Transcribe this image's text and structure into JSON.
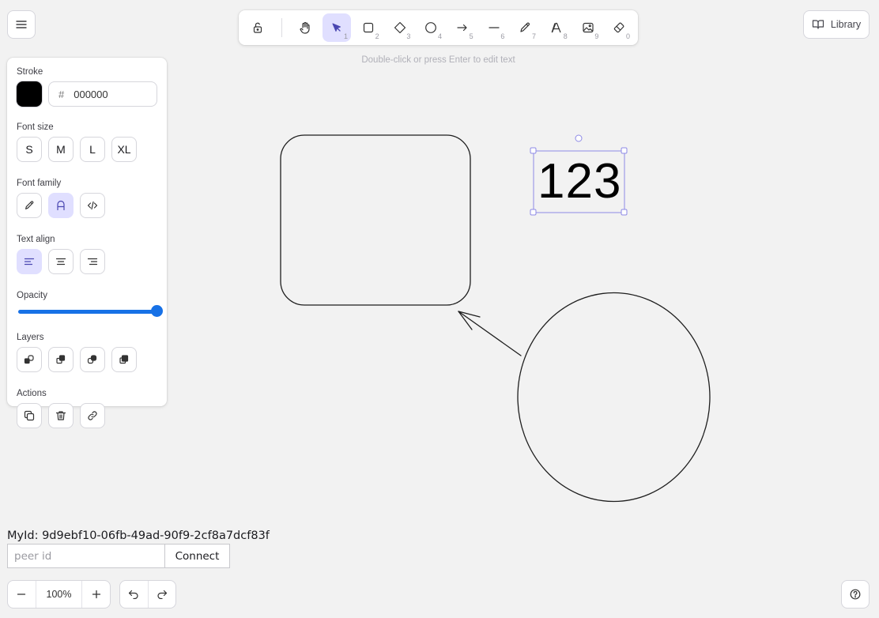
{
  "toolbar": {
    "tools": [
      {
        "name": "lock",
        "key": ""
      },
      {
        "name": "hand",
        "key": ""
      },
      {
        "name": "selection",
        "key": "1"
      },
      {
        "name": "rectangle",
        "key": "2"
      },
      {
        "name": "diamond",
        "key": "3"
      },
      {
        "name": "ellipse",
        "key": "4"
      },
      {
        "name": "arrow",
        "key": "5"
      },
      {
        "name": "line",
        "key": "6"
      },
      {
        "name": "draw",
        "key": "7"
      },
      {
        "name": "text",
        "key": "8"
      },
      {
        "name": "image",
        "key": "9"
      },
      {
        "name": "eraser",
        "key": "0"
      }
    ],
    "active_tool": "selection"
  },
  "hint": "Double-click or press Enter to edit text",
  "library": {
    "label": "Library"
  },
  "properties": {
    "stroke": {
      "title": "Stroke",
      "color": "#000000",
      "hash": "#",
      "hex_value": "000000"
    },
    "font_size": {
      "title": "Font size",
      "options": [
        "S",
        "M",
        "L",
        "XL"
      ]
    },
    "font_family": {
      "title": "Font family",
      "options": [
        "hand-drawn",
        "normal",
        "code"
      ],
      "selected": "normal"
    },
    "text_align": {
      "title": "Text align",
      "options": [
        "left",
        "center",
        "right"
      ],
      "selected": "left"
    },
    "opacity": {
      "title": "Opacity",
      "value": 100
    },
    "layers": {
      "title": "Layers"
    },
    "actions": {
      "title": "Actions"
    }
  },
  "canvas": {
    "selected_text": "123"
  },
  "collab": {
    "myid_label": "MyId:",
    "myid_value": "9d9ebf10-06fb-49ad-90f9-2cf8a7dcf83f",
    "peer_placeholder": "peer id",
    "connect_label": "Connect"
  },
  "zoom": {
    "level": "100%"
  },
  "colors": {
    "accent": "#e0dfff",
    "accent_dark": "#6965db",
    "slider": "#1771e6"
  }
}
